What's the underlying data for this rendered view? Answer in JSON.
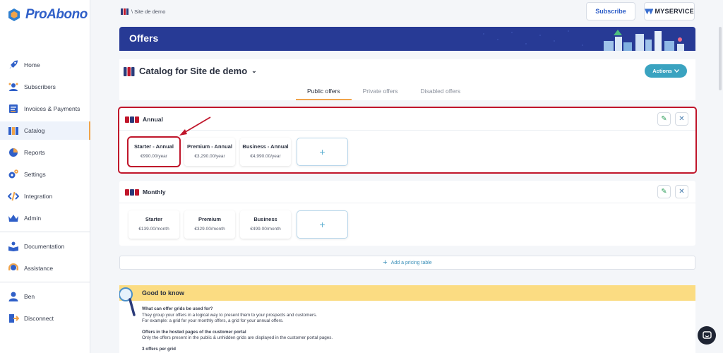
{
  "app": {
    "name": "ProAbono"
  },
  "nav": {
    "home": "Home",
    "subscribers": "Subscribers",
    "invoices": "Invoices & Payments",
    "catalog": "Catalog",
    "reports": "Reports",
    "settings": "Settings",
    "integration": "Integration",
    "admin": "Admin",
    "documentation": "Documentation",
    "assistance": "Assistance",
    "user": "Ben",
    "disconnect": "Disconnect"
  },
  "topbar": {
    "breadcrumb": "\\ Site de demo",
    "subscribe": "Subscribe",
    "brand": "MYSERVICE"
  },
  "banner": {
    "title": "Offers"
  },
  "catalog": {
    "title": "Catalog for Site de demo",
    "actions": "Actions",
    "tabs": [
      "Public offers",
      "Private offers",
      "Disabled offers"
    ]
  },
  "grids": [
    {
      "title": "Annual",
      "offers": [
        {
          "name": "Starter - Annual",
          "price": "€990.00/year"
        },
        {
          "name": "Premium - Annual",
          "price": "€3,290.00/year"
        },
        {
          "name": "Business - Annual",
          "price": "€4,990.00/year"
        }
      ]
    },
    {
      "title": "Monthly",
      "offers": [
        {
          "name": "Starter",
          "price": "€139.00/month"
        },
        {
          "name": "Premium",
          "price": "€329.00/month"
        },
        {
          "name": "Business",
          "price": "€499.00/month"
        }
      ]
    }
  ],
  "add_offer_symbol": "+",
  "add_pricing_table": "Add a pricing table",
  "good_to_know": {
    "title": "Good to know",
    "q1": "What can offer grids be used for?",
    "a1": "They group your offers in a logical way to present them to your prospects and customers.",
    "a1b": "For example: a grid for your monthly offers, a grid for your annual offers.",
    "q2": "Offers in the hosted pages of the customer portal",
    "a2": "Only the offers present in the public & unhidden grids are displayed in the customer portal pages.",
    "q3": "3 offers per grid"
  },
  "colors": {
    "accent": "#2f5fc8",
    "banner": "#273a95",
    "highlight": "#c0162b",
    "tab_underline": "#f0a44b",
    "good_to_know": "#fbdc82"
  }
}
